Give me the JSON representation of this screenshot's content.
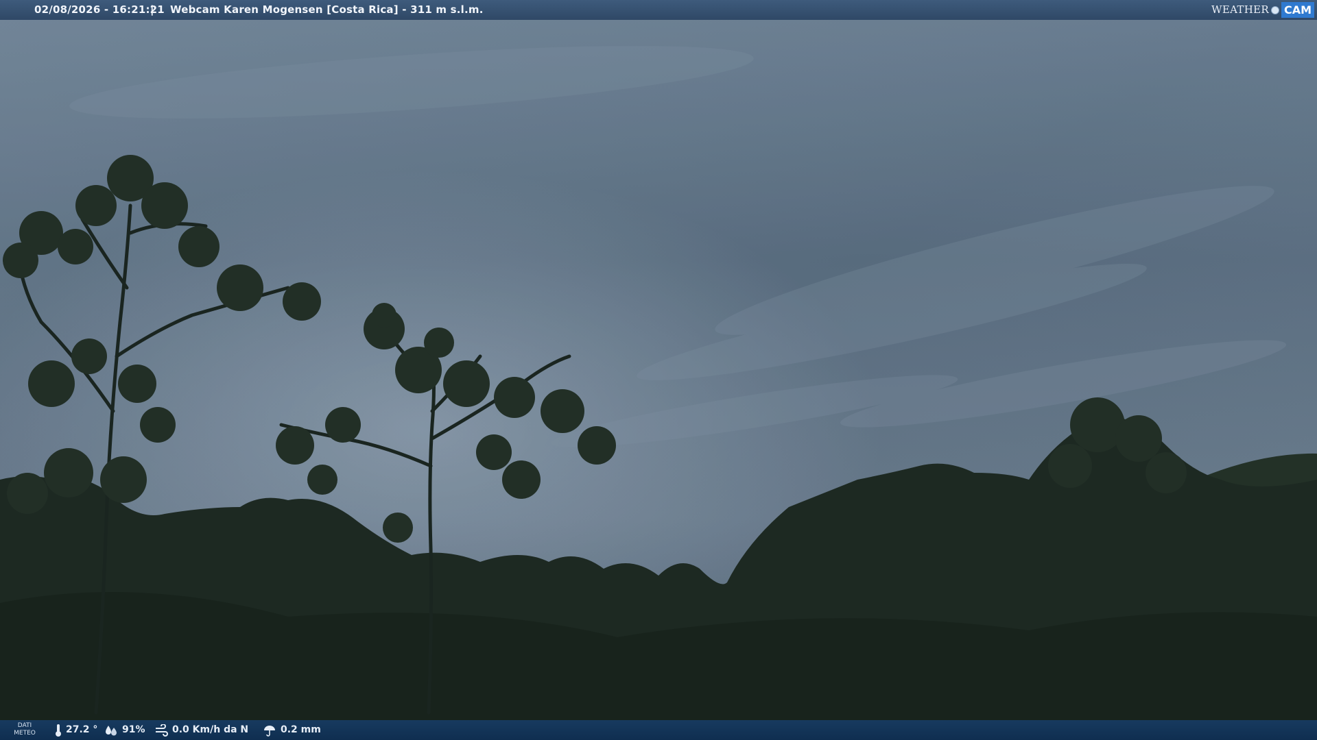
{
  "overlay": {
    "timestamp": "02/08/2026 - 16:21:21",
    "separator": "|",
    "title": "Webcam Karen Mogensen [Costa Rica]  - 311 m s.l.m."
  },
  "logo": {
    "weather": "WEATHER",
    "cam": "CAM"
  },
  "weather_bar": {
    "label_line1": "DATI",
    "label_line2": "METEO",
    "temperature": "27.2 °",
    "humidity": "91%",
    "wind": "0.0 Km/h da N",
    "rain": "0.2 mm"
  },
  "icons": {
    "temperature": "thermometer-icon",
    "humidity": "humidity-drops-icon",
    "wind": "wind-icon",
    "rain": "rain-umbrella-icon"
  }
}
